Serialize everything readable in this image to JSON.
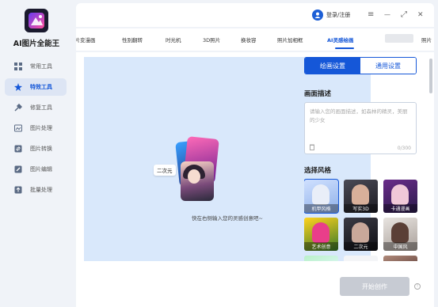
{
  "app": {
    "title": "AI图片全能王"
  },
  "sidebar": {
    "items": [
      {
        "label": "常用工具",
        "icon": "grid-icon"
      },
      {
        "label": "特效工具",
        "icon": "magic-wand-icon",
        "active": true
      },
      {
        "label": "修复工具",
        "icon": "repair-icon"
      },
      {
        "label": "图片处理",
        "icon": "image-process-icon"
      },
      {
        "label": "图片转换",
        "icon": "image-convert-icon"
      },
      {
        "label": "图片编辑",
        "icon": "image-edit-icon"
      },
      {
        "label": "批量处理",
        "icon": "batch-upload-icon"
      }
    ]
  },
  "header": {
    "login_label": "登录/注册",
    "menu_glyph": "≡",
    "minimize_glyph": "—",
    "maximize_glyph": "⤢",
    "close_glyph": "✕"
  },
  "tabs": [
    {
      "label": "照片变漫画"
    },
    {
      "label": "性别翻转"
    },
    {
      "label": "时光机"
    },
    {
      "label": "3D照片"
    },
    {
      "label": "换妆容"
    },
    {
      "label": "照片加相框"
    },
    {
      "label": "AI灵感绘画",
      "active": true
    },
    {
      "label": "照片"
    }
  ],
  "canvas": {
    "badge": "二次元",
    "hint": "快在右侧输入您的灵感创意吧~"
  },
  "panel": {
    "tab_painting": "绘画设置",
    "tab_general": "通用设置",
    "desc_title": "画面描述",
    "desc_placeholder": "请输入您的画面描述，如森林的精灵，美丽的少女",
    "counter": "0/300",
    "style_title": "选择风格",
    "styles": [
      {
        "label": "机甲风格",
        "selected": true
      },
      {
        "label": "写实3D"
      },
      {
        "label": "卡通漫画"
      },
      {
        "label": "艺术创意"
      },
      {
        "label": "二次元"
      },
      {
        "label": "中国风"
      }
    ]
  },
  "footer": {
    "start_label": "开始创作"
  },
  "colors": {
    "accent": "#1557d8",
    "canvas_bg": "#d9e8fb",
    "disabled_btn": "#c7cbd3"
  }
}
